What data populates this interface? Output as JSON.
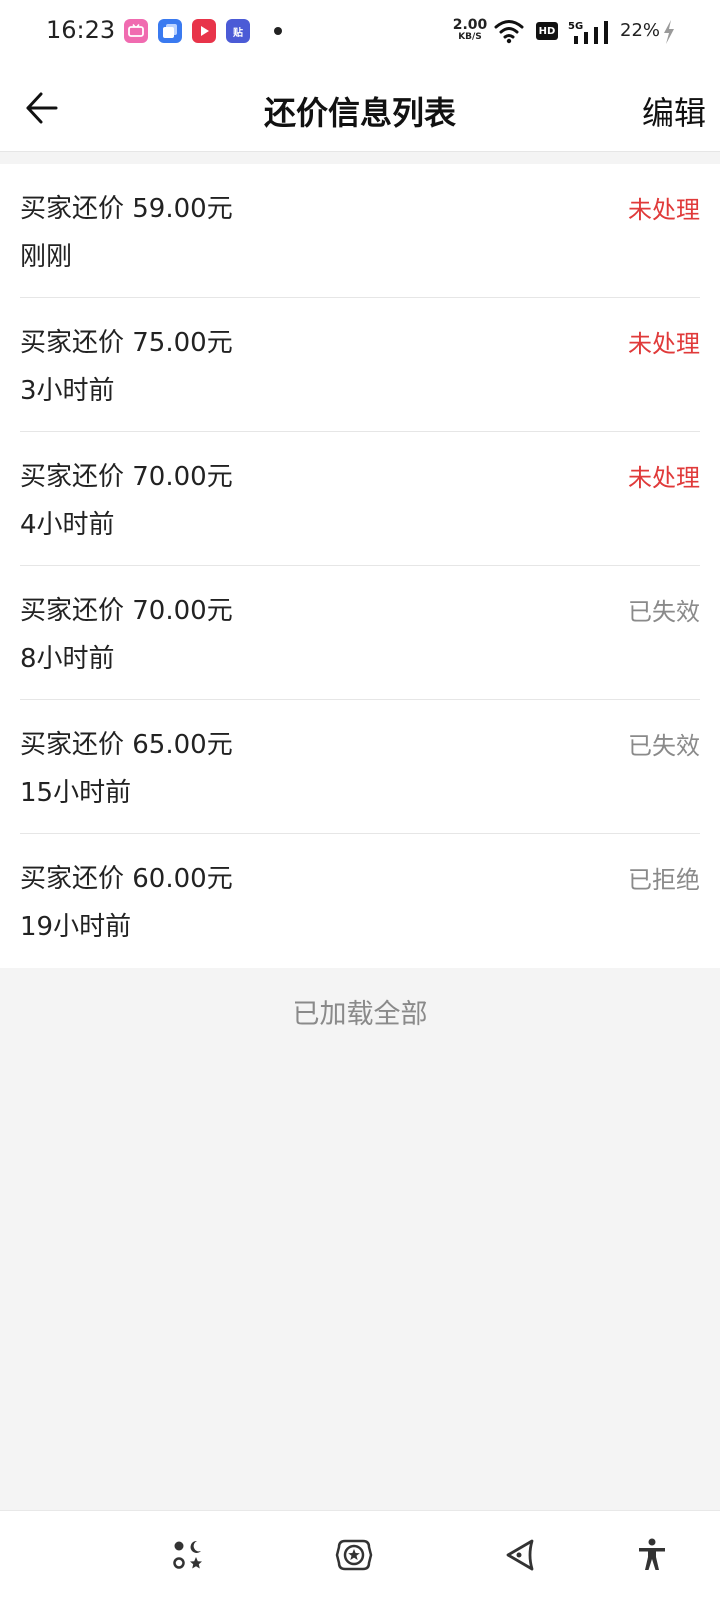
{
  "status_bar": {
    "time": "16:23",
    "speed_value": "2.00",
    "speed_unit": "KB/S",
    "hd_badge": "HD",
    "network": "5G",
    "battery": "22%",
    "app_icon_4": "贴"
  },
  "header": {
    "title": "还价信息列表",
    "edit_label": "编辑"
  },
  "offers": [
    {
      "title": "买家还价 59.00元",
      "time": "刚刚",
      "status": "未处理",
      "status_color": "#e03a3a"
    },
    {
      "title": "买家还价 75.00元",
      "time": "3小时前",
      "status": "未处理",
      "status_color": "#e03a3a"
    },
    {
      "title": "买家还价 70.00元",
      "time": "4小时前",
      "status": "未处理",
      "status_color": "#e03a3a"
    },
    {
      "title": "买家还价 70.00元",
      "time": "8小时前",
      "status": "已失效",
      "status_color": "#8a8a8a"
    },
    {
      "title": "买家还价 65.00元",
      "time": "15小时前",
      "status": "已失效",
      "status_color": "#8a8a8a"
    },
    {
      "title": "买家还价 60.00元",
      "time": "19小时前",
      "status": "已拒绝",
      "status_color": "#8a8a8a"
    }
  ],
  "footer": {
    "loaded_all": "已加载全部"
  },
  "bottom_bar": {
    "icons": [
      "theme-mode-icon",
      "floating-ball-icon",
      "back-gesture-icon",
      "accessibility-icon"
    ]
  }
}
